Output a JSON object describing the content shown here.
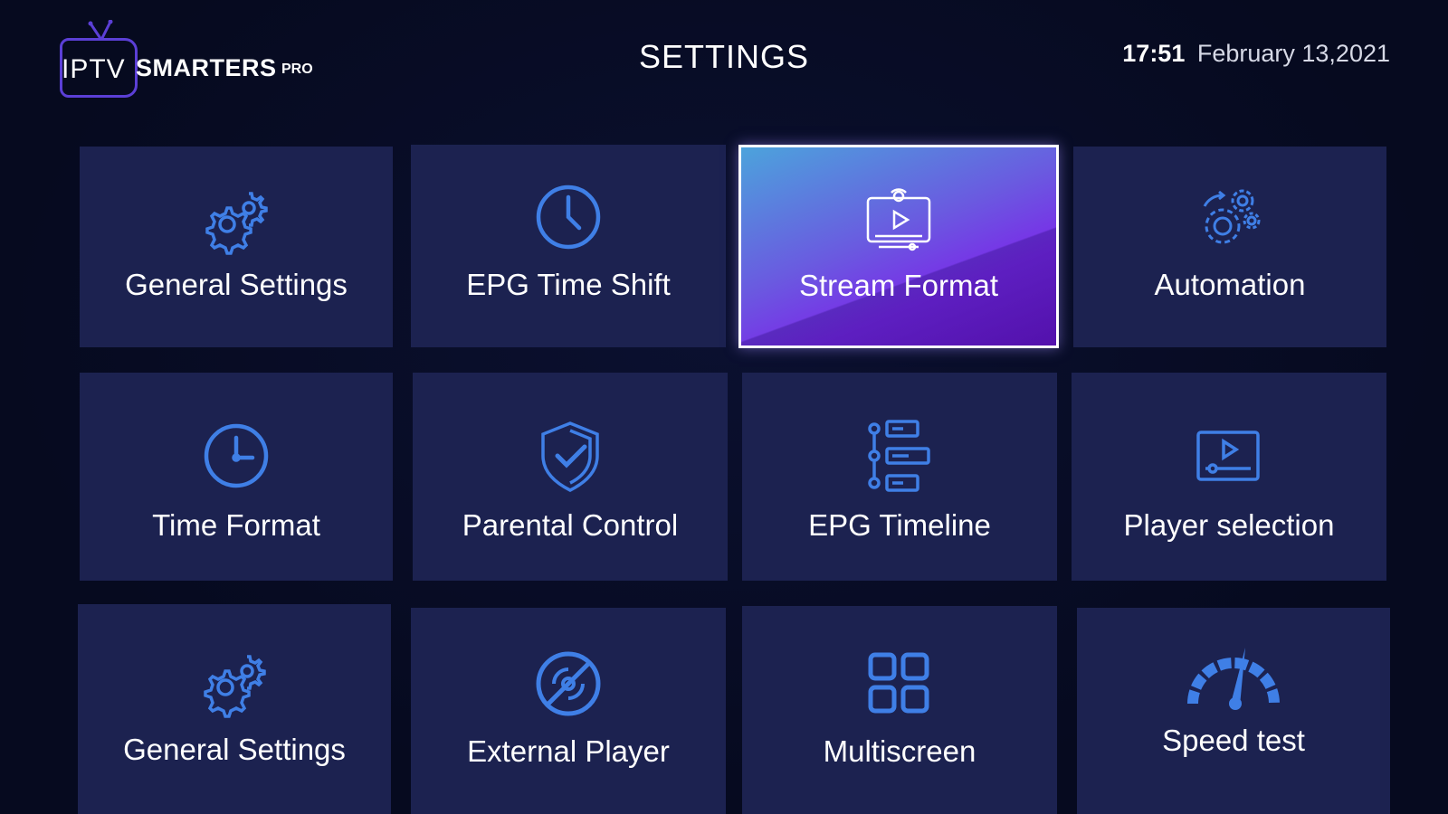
{
  "header": {
    "logo": {
      "iptv": "IPTV",
      "name": "SMARTERS",
      "pro": "PRO"
    },
    "title": "SETTINGS",
    "time": "17:51",
    "date": "February 13,2021"
  },
  "colors": {
    "background": "#070b22",
    "tile": "#1c2250",
    "icon": "#3f7fe6",
    "accent": "#5b3fd6"
  },
  "tiles": [
    {
      "label": "General Settings",
      "icon": "gears-icon"
    },
    {
      "label": "EPG Time Shift",
      "icon": "clock-icon"
    },
    {
      "label": "Stream Format",
      "icon": "monitor-play-icon",
      "selected": true
    },
    {
      "label": "Automation",
      "icon": "automation-gears-icon"
    },
    {
      "label": "Time Format",
      "icon": "clock-icon"
    },
    {
      "label": "Parental  Control",
      "icon": "shield-check-icon"
    },
    {
      "label": "EPG Timeline",
      "icon": "timeline-icon"
    },
    {
      "label": "Player selection",
      "icon": "player-icon"
    },
    {
      "label": "General Settings",
      "icon": "gears-icon"
    },
    {
      "label": "External Player",
      "icon": "disc-slash-icon"
    },
    {
      "label": "Multiscreen",
      "icon": "grid-icon"
    },
    {
      "label": "Speed test",
      "icon": "speedometer-icon"
    }
  ]
}
